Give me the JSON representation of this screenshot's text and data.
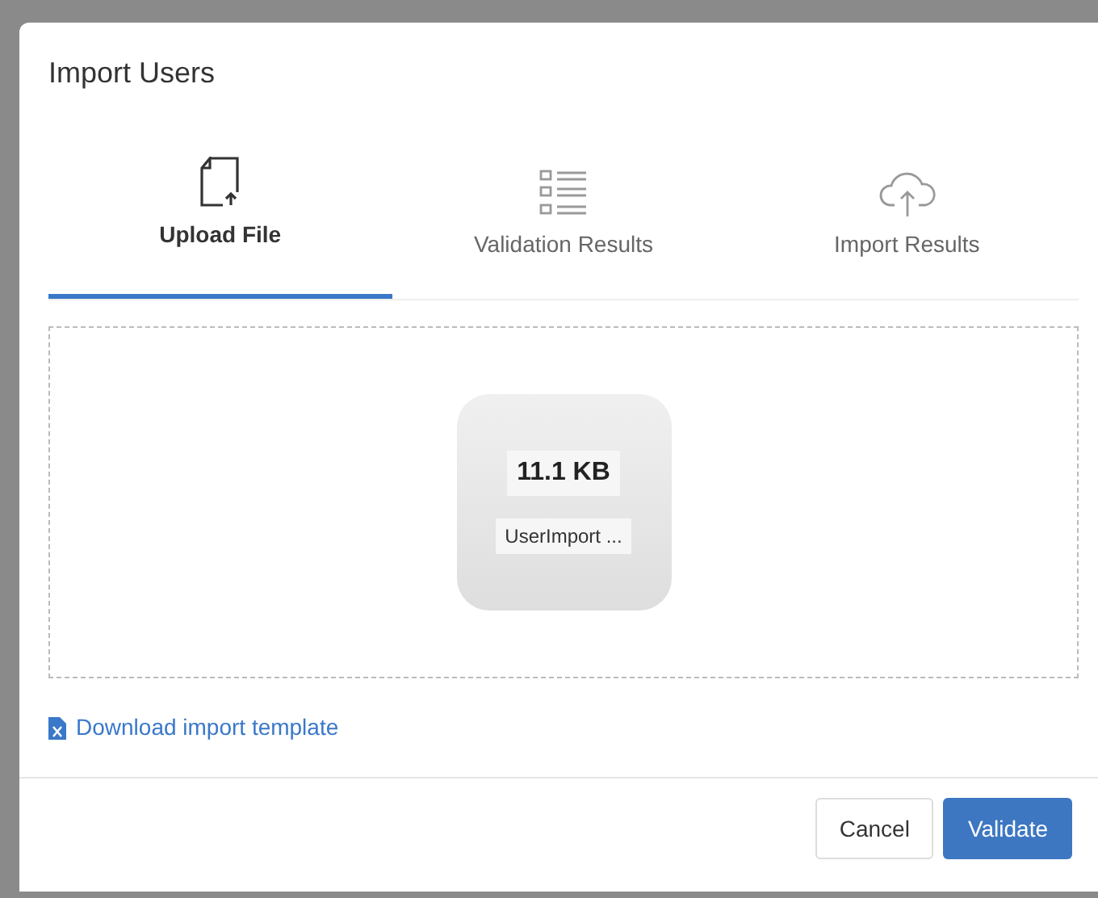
{
  "dialog": {
    "title": "Import Users"
  },
  "tabs": [
    {
      "label": "Upload File",
      "kind": "upload",
      "selected": true
    },
    {
      "label": "Validation Results",
      "kind": "checklist",
      "selected": false
    },
    {
      "label": "Import Results",
      "kind": "cloud",
      "selected": false
    }
  ],
  "file": {
    "size": "11.1 KB",
    "name": "UserImport ..."
  },
  "template_link": "Download import template",
  "buttons": [
    {
      "label": "Cancel",
      "kind": "secondary"
    },
    {
      "label": "Validate",
      "kind": "primary"
    }
  ]
}
